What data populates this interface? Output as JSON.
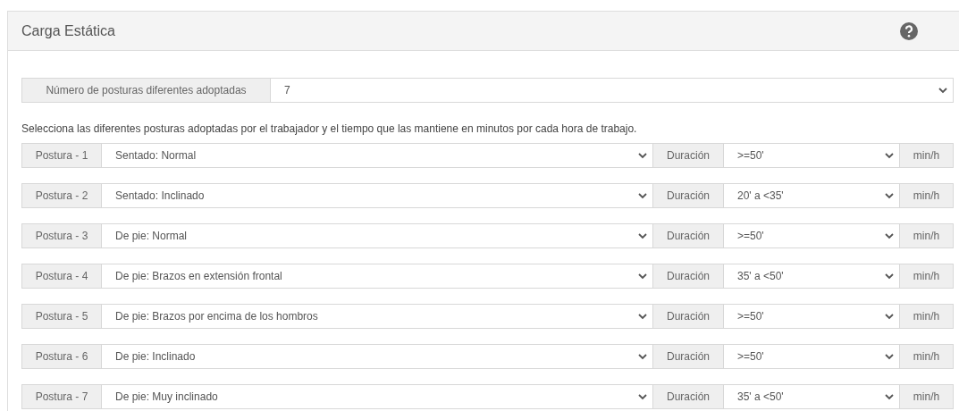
{
  "panel": {
    "title": "Carga Estática"
  },
  "count": {
    "label": "Número de posturas diferentes adoptadas",
    "value": "7"
  },
  "instructions": "Selecciona las diferentes posturas adoptadas por el trabajador y el tiempo que las mantiene en minutos por cada hora de trabajo.",
  "postures": [
    {
      "label": "Postura - 1",
      "posture": "Sentado: Normal",
      "duration_label": "Duración",
      "duration": ">=50'",
      "unit": "min/h"
    },
    {
      "label": "Postura - 2",
      "posture": "Sentado: Inclinado",
      "duration_label": "Duración",
      "duration": "20' a <35'",
      "unit": "min/h"
    },
    {
      "label": "Postura - 3",
      "posture": "De pie: Normal",
      "duration_label": "Duración",
      "duration": ">=50'",
      "unit": "min/h"
    },
    {
      "label": "Postura - 4",
      "posture": "De pie: Brazos en extensión frontal",
      "duration_label": "Duración",
      "duration": "35' a <50'",
      "unit": "min/h"
    },
    {
      "label": "Postura - 5",
      "posture": "De pie: Brazos por encima de los hombros",
      "duration_label": "Duración",
      "duration": ">=50'",
      "unit": "min/h"
    },
    {
      "label": "Postura - 6",
      "posture": "De pie: Inclinado",
      "duration_label": "Duración",
      "duration": ">=50'",
      "unit": "min/h"
    },
    {
      "label": "Postura - 7",
      "posture": "De pie: Muy inclinado",
      "duration_label": "Duración",
      "duration": "35' a <50'",
      "unit": "min/h"
    }
  ]
}
